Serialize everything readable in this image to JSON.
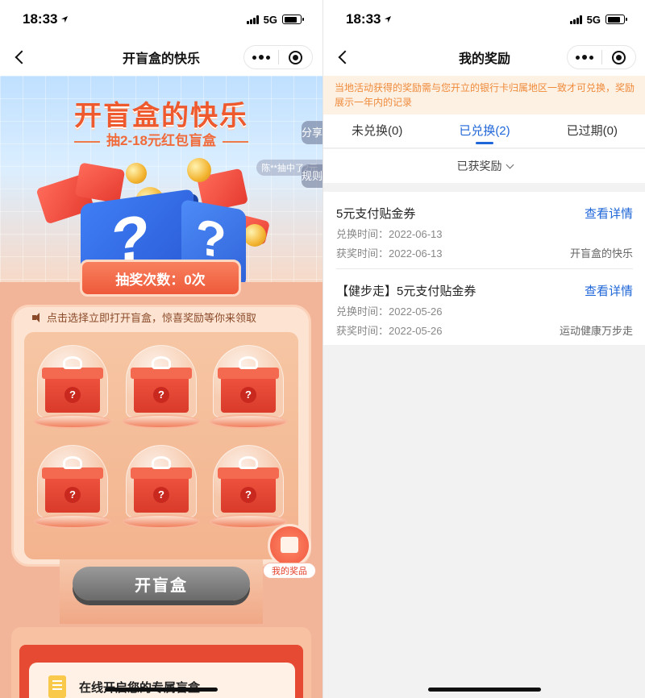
{
  "left": {
    "status": {
      "time": "18:33",
      "network": "5G"
    },
    "nav": {
      "title": "开盲盒的快乐"
    },
    "hero": {
      "title": "开盲盒的快乐",
      "subtitle": "抽2-18元红包盲盒",
      "ticker": "陈**抽中了2元",
      "share_label": "分享",
      "rules_label": "规则"
    },
    "draw_count": "抽奖次数：0次",
    "notice": "点击选择立即打开盲盒，惊喜奖励等你来领取",
    "gift_mark": "?",
    "my_prize": "我的奖品",
    "open_button": "开盲盒",
    "exclusive_text": "在线开启您的专属盲盒"
  },
  "right": {
    "status": {
      "time": "18:33",
      "network": "5G"
    },
    "nav": {
      "title": "我的奖励"
    },
    "notice": "当地活动获得的奖励需与您开立的银行卡归属地区一致才可兑换，奖励展示一年内的记录",
    "tabs": [
      {
        "label": "未兑换(0)"
      },
      {
        "label": "已兑换(2)"
      },
      {
        "label": "已过期(0)"
      }
    ],
    "filter": "已获奖励",
    "records": [
      {
        "title": "5元支付贴金券",
        "detail": "查看详情",
        "exchange_time": "兑换时间：2022-06-13",
        "award_time": "获奖时间：2022-06-13",
        "source": "开盲盒的快乐"
      },
      {
        "title": "【健步走】5元支付贴金券",
        "detail": "查看详情",
        "exchange_time": "兑换时间：2022-05-26",
        "award_time": "获奖时间：2022-05-26",
        "source": "运动健康万步走"
      }
    ]
  },
  "colors": {
    "accent_blue": "#1f66d8",
    "accent_orange": "#ee5a2e",
    "notice_orange": "#ef8a3a"
  }
}
